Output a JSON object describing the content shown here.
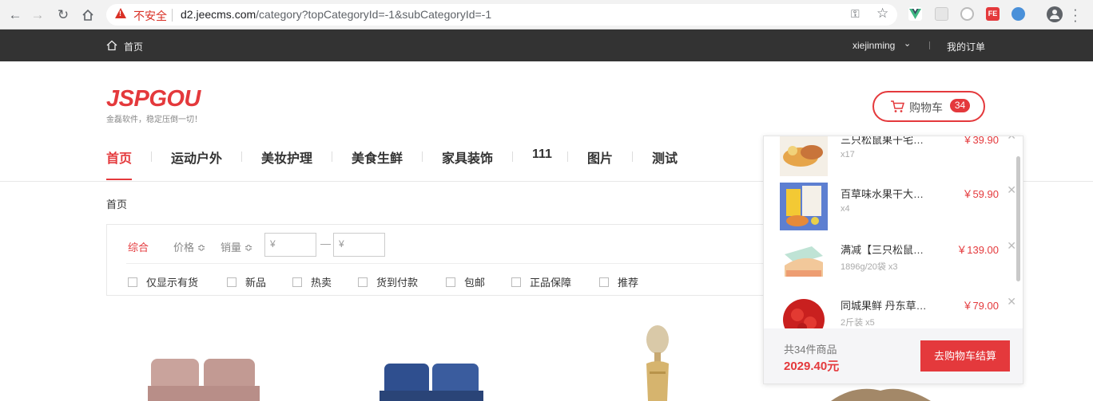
{
  "browser": {
    "insecure_label": "不安全",
    "url_host": "d2.jeecms.com",
    "url_path": "/category?topCategoryId=-1&subCategoryId=-1"
  },
  "topbar": {
    "home_label": "首页",
    "username": "xiejinming",
    "orders_label": "我的订单"
  },
  "header": {
    "logo_text": "JSPGOU",
    "slogan": "金磊软件，稳定压倒一切！",
    "cart_label": "购物车",
    "cart_count": "34"
  },
  "category_nav": {
    "items": [
      "首页",
      "运动户外",
      "美妆护理",
      "美食生鲜",
      "家具装饰",
      "111",
      "图片",
      "测试"
    ],
    "active_index": 0
  },
  "breadcrumb": "首页",
  "filters": {
    "sort_default": "综合",
    "sort_price": "价格 ≎",
    "sort_sales": "销量 ≎",
    "price_min_placeholder": "¥",
    "price_max_placeholder": "¥",
    "dash": "—",
    "checkboxes": [
      "仅显示有货",
      "新品",
      "热卖",
      "货到付款",
      "包邮",
      "正品保障",
      "推荐"
    ]
  },
  "cart_popup": {
    "items": [
      {
        "name": "三只松鼠果干宅…",
        "sub": "x17",
        "price": "￥39.90"
      },
      {
        "name": "百草味水果干大…",
        "sub": "x4",
        "price": "￥59.90"
      },
      {
        "name": "满减【三只松鼠…",
        "sub": "1896g/20袋 x3",
        "price": "￥139.00"
      },
      {
        "name": "同城果鲜 丹东草…",
        "sub": "2斤装 x5",
        "price": "￥79.00"
      }
    ],
    "remove_label": "✕",
    "count_text": "共34件商品",
    "total": "2029.40元",
    "checkout_label": "去购物车结算"
  },
  "colors": {
    "brand_red": "#e4393c",
    "topbar_bg": "#333333"
  }
}
